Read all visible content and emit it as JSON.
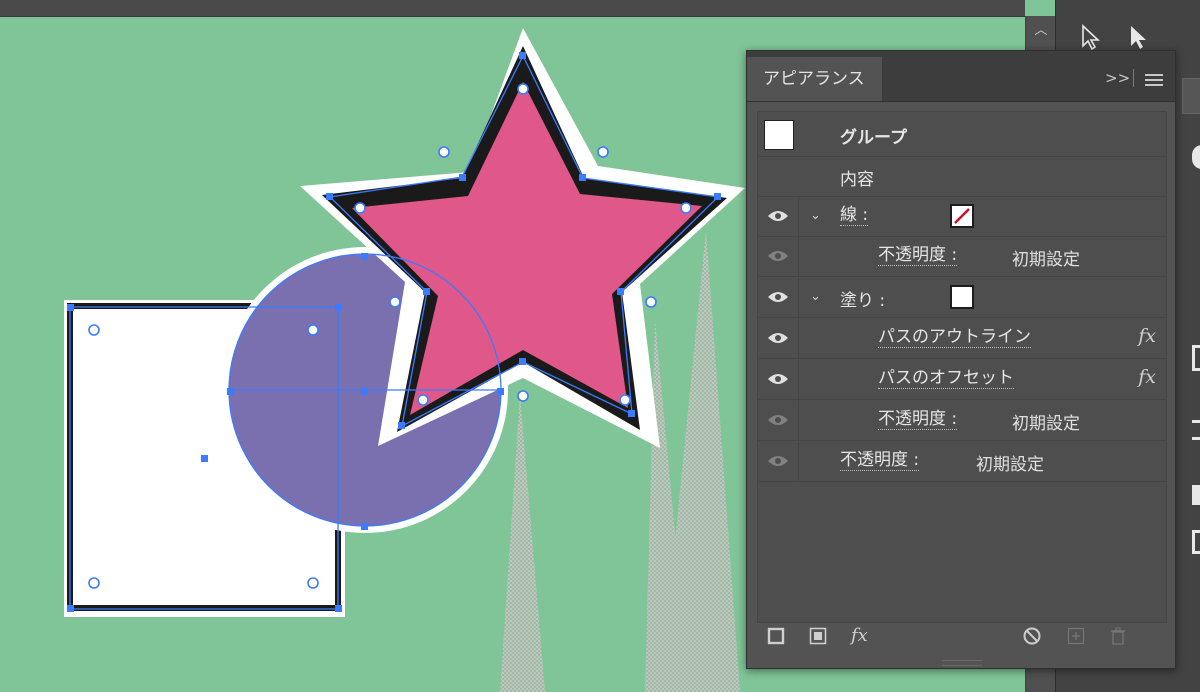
{
  "panel": {
    "tab_label": "アピアランス",
    "collapse_label": ">>",
    "object_label": "グループ",
    "contents_label": "内容",
    "rows": [
      {
        "label": "線 :",
        "value": ""
      },
      {
        "label": "不透明度 :",
        "value": "初期設定"
      },
      {
        "label": "塗り :",
        "value": ""
      },
      {
        "label": "パスのアウトライン",
        "value": ""
      },
      {
        "label": "パスのオフセット",
        "value": ""
      },
      {
        "label": "不透明度 :",
        "value": "初期設定"
      },
      {
        "label": "不透明度 :",
        "value": "初期設定"
      }
    ],
    "fx_label": "fx"
  },
  "colors": {
    "canvas_bg": "#7fc597",
    "star_fill": "#e0578a",
    "circle_fill": "#7a70b0",
    "selection_blue": "#3a7bff",
    "stroke_swatch_slash": "#c8102e"
  },
  "icons": [
    "eye-icon",
    "chevron-down-icon",
    "fx-icon",
    "new-stroke-icon",
    "new-fill-icon",
    "clear-appearance-icon",
    "duplicate-item-icon",
    "delete-icon",
    "menu-icon",
    "selection-tool-icon",
    "direct-selection-tool-icon"
  ]
}
